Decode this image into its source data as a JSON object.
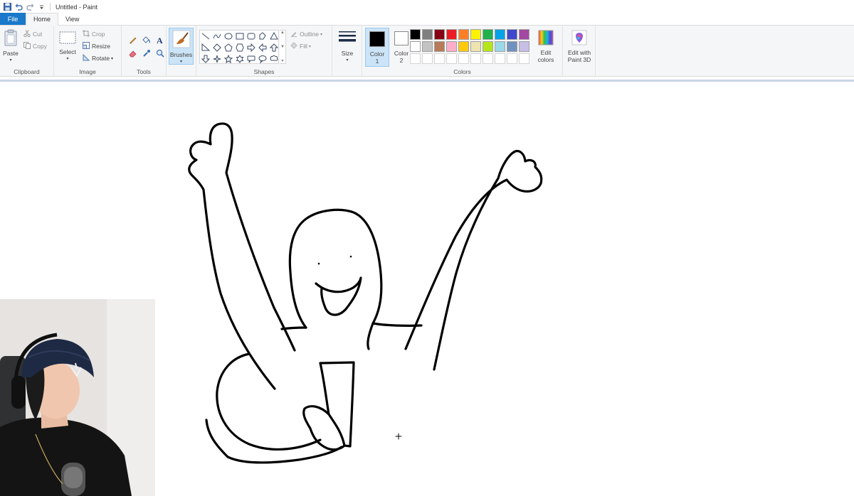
{
  "window": {
    "title": "Untitled - Paint"
  },
  "tabs": [
    {
      "label": "File"
    },
    {
      "label": "Home"
    },
    {
      "label": "View"
    }
  ],
  "ribbon": {
    "clipboard": {
      "label": "Clipboard",
      "paste": "Paste",
      "cut": "Cut",
      "copy": "Copy"
    },
    "image": {
      "label": "Image",
      "select": "Select",
      "crop": "Crop",
      "resize": "Resize",
      "rotate": "Rotate"
    },
    "tools": {
      "label": "Tools",
      "items": [
        "pencil-icon",
        "fill-icon",
        "text-icon",
        "eraser-icon",
        "color-picker-icon",
        "magnifier-icon"
      ]
    },
    "brushes": {
      "label": "Brushes"
    },
    "shapes": {
      "label": "Shapes",
      "outline": "Outline",
      "fill": "Fill"
    },
    "size": {
      "label": "Size"
    },
    "colors": {
      "label": "Colors",
      "color1": {
        "label": "Color",
        "number": "1",
        "value": "#000000"
      },
      "color2": {
        "label": "Color",
        "number": "2",
        "value": "#ffffff"
      },
      "palette_row1": [
        "#000000",
        "#7f7f7f",
        "#880015",
        "#ed1c24",
        "#ff7f27",
        "#fff200",
        "#22b14c",
        "#00a2e8",
        "#3f48cc",
        "#a349a4"
      ],
      "palette_row2": [
        "#ffffff",
        "#c3c3c3",
        "#b97a57",
        "#ffaec9",
        "#ffc90e",
        "#efe4b0",
        "#b5e61d",
        "#99d9ea",
        "#7092be",
        "#c8bfe7"
      ],
      "edit_colors": "Edit colors"
    },
    "paint3d": {
      "label": "Edit with Paint 3D"
    }
  },
  "accent": "#1979ca"
}
